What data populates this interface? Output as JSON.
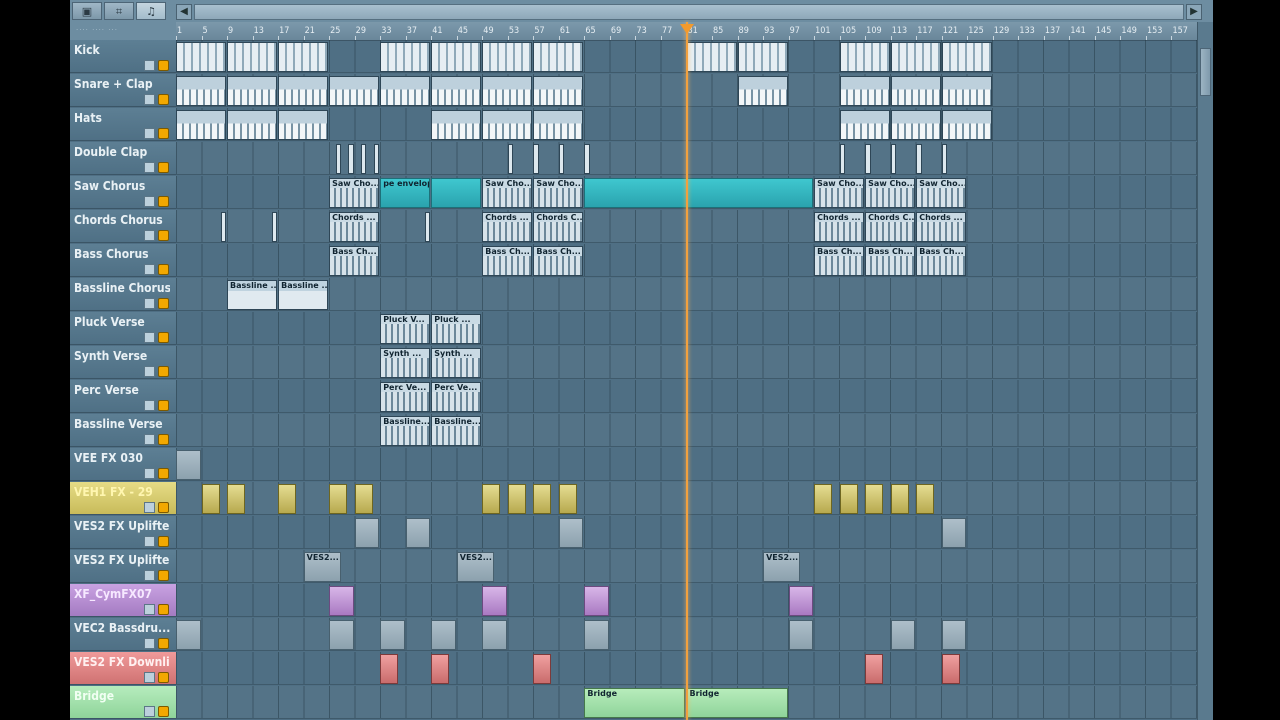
{
  "mode_buttons": [
    "▣",
    "⌗",
    "♫"
  ],
  "presets_label": "···· ···· ···",
  "scroll_arrows": {
    "left": "◀",
    "right": "▶"
  },
  "ruler": {
    "labels": [
      "1",
      "5",
      "9",
      "13",
      "17",
      "21",
      "25",
      "29",
      "33",
      "37",
      "41",
      "45",
      "49",
      "53",
      "57",
      "61",
      "65",
      "69",
      "73",
      "77",
      "81",
      "85",
      "89",
      "93",
      "97",
      "101",
      "105",
      "109",
      "113",
      "117",
      "121",
      "125",
      "129",
      "133",
      "137",
      "141",
      "145",
      "149",
      "153",
      "157"
    ],
    "label_step": 4,
    "bars_visible": 160,
    "playhead_bar": 81
  },
  "tracks": [
    {
      "name": "Kick",
      "color": "default",
      "clips": [
        {
          "start": 1,
          "len": 8,
          "style": "drum"
        },
        {
          "start": 9,
          "len": 8,
          "style": "drum"
        },
        {
          "start": 17,
          "len": 8,
          "style": "drum"
        },
        {
          "start": 33,
          "len": 8,
          "style": "drum"
        },
        {
          "start": 41,
          "len": 8,
          "style": "drum"
        },
        {
          "start": 49,
          "len": 8,
          "style": "drum"
        },
        {
          "start": 57,
          "len": 8,
          "style": "drum"
        },
        {
          "start": 81,
          "len": 8,
          "style": "drum"
        },
        {
          "start": 89,
          "len": 8,
          "style": "drum"
        },
        {
          "start": 105,
          "len": 8,
          "style": "drum"
        },
        {
          "start": 113,
          "len": 8,
          "style": "drum"
        },
        {
          "start": 121,
          "len": 8,
          "style": "drum"
        }
      ]
    },
    {
      "name": "Snare + Clap",
      "color": "default",
      "clips": [
        {
          "start": 1,
          "len": 8,
          "style": "drum2"
        },
        {
          "start": 9,
          "len": 8,
          "style": "drum2"
        },
        {
          "start": 17,
          "len": 8,
          "style": "drum2"
        },
        {
          "start": 25,
          "len": 8,
          "style": "drum2"
        },
        {
          "start": 33,
          "len": 8,
          "style": "drum2"
        },
        {
          "start": 41,
          "len": 8,
          "style": "drum2"
        },
        {
          "start": 49,
          "len": 8,
          "style": "drum2"
        },
        {
          "start": 57,
          "len": 8,
          "style": "drum2"
        },
        {
          "start": 89,
          "len": 8,
          "style": "drum2"
        },
        {
          "start": 105,
          "len": 8,
          "style": "drum2"
        },
        {
          "start": 113,
          "len": 8,
          "style": "drum2"
        },
        {
          "start": 121,
          "len": 8,
          "style": "drum2"
        }
      ]
    },
    {
      "name": "Hats",
      "color": "default",
      "clips": [
        {
          "start": 1,
          "len": 8,
          "style": "drum2"
        },
        {
          "start": 9,
          "len": 8,
          "style": "drum2"
        },
        {
          "start": 17,
          "len": 8,
          "style": "drum2"
        },
        {
          "start": 41,
          "len": 8,
          "style": "drum2"
        },
        {
          "start": 49,
          "len": 8,
          "style": "drum2"
        },
        {
          "start": 57,
          "len": 8,
          "style": "drum2"
        },
        {
          "start": 105,
          "len": 8,
          "style": "drum2"
        },
        {
          "start": 113,
          "len": 8,
          "style": "drum2"
        },
        {
          "start": 121,
          "len": 8,
          "style": "drum2"
        }
      ]
    },
    {
      "name": "Double Clap",
      "color": "default",
      "clips": [
        {
          "start": 26,
          "len": 1,
          "style": "tiny"
        },
        {
          "start": 28,
          "len": 1,
          "style": "tiny"
        },
        {
          "start": 30,
          "len": 1,
          "style": "tiny"
        },
        {
          "start": 32,
          "len": 1,
          "style": "tiny"
        },
        {
          "start": 53,
          "len": 1,
          "style": "tiny"
        },
        {
          "start": 57,
          "len": 1,
          "style": "tiny"
        },
        {
          "start": 61,
          "len": 1,
          "style": "tiny"
        },
        {
          "start": 65,
          "len": 1,
          "style": "tiny"
        },
        {
          "start": 105,
          "len": 1,
          "style": "tiny"
        },
        {
          "start": 109,
          "len": 1,
          "style": "tiny"
        },
        {
          "start": 113,
          "len": 1,
          "style": "tiny"
        },
        {
          "start": 117,
          "len": 1,
          "style": "tiny"
        },
        {
          "start": 121,
          "len": 1,
          "style": "tiny"
        }
      ]
    },
    {
      "name": "Saw Chorus",
      "color": "default",
      "clips": [
        {
          "start": 25,
          "len": 8,
          "style": "pat",
          "label": "Saw Cho..."
        },
        {
          "start": 33,
          "len": 8,
          "style": "cyan",
          "label": "pe envelope"
        },
        {
          "start": 41,
          "len": 8,
          "style": "cyan",
          "label": ""
        },
        {
          "start": 49,
          "len": 8,
          "style": "pat",
          "label": "Saw Cho..."
        },
        {
          "start": 57,
          "len": 8,
          "style": "pat",
          "label": "Saw Cho..."
        },
        {
          "start": 65,
          "len": 36,
          "style": "cyan",
          "label": ""
        },
        {
          "start": 101,
          "len": 8,
          "style": "pat",
          "label": "Saw Cho..."
        },
        {
          "start": 109,
          "len": 8,
          "style": "pat",
          "label": "Saw Cho..."
        },
        {
          "start": 117,
          "len": 8,
          "style": "pat",
          "label": "Saw Cho..."
        }
      ]
    },
    {
      "name": "Chords Chorus",
      "color": "default",
      "clips": [
        {
          "start": 8,
          "len": 1,
          "style": "tiny"
        },
        {
          "start": 16,
          "len": 1,
          "style": "tiny"
        },
        {
          "start": 25,
          "len": 8,
          "style": "pat",
          "label": "Chords ..."
        },
        {
          "start": 40,
          "len": 1,
          "style": "tiny"
        },
        {
          "start": 49,
          "len": 8,
          "style": "pat",
          "label": "Chords ..."
        },
        {
          "start": 57,
          "len": 8,
          "style": "pat",
          "label": "Chords C..."
        },
        {
          "start": 101,
          "len": 8,
          "style": "pat",
          "label": "Chords ..."
        },
        {
          "start": 109,
          "len": 8,
          "style": "pat",
          "label": "Chords C..."
        },
        {
          "start": 117,
          "len": 8,
          "style": "pat",
          "label": "Chords ..."
        }
      ]
    },
    {
      "name": "Bass Chorus",
      "color": "default",
      "clips": [
        {
          "start": 25,
          "len": 8,
          "style": "pat",
          "label": "Bass Ch..."
        },
        {
          "start": 49,
          "len": 8,
          "style": "pat",
          "label": "Bass Ch..."
        },
        {
          "start": 57,
          "len": 8,
          "style": "pat",
          "label": "Bass Ch..."
        },
        {
          "start": 101,
          "len": 8,
          "style": "pat",
          "label": "Bass Ch..."
        },
        {
          "start": 109,
          "len": 8,
          "style": "pat",
          "label": "Bass Ch..."
        },
        {
          "start": 117,
          "len": 8,
          "style": "pat",
          "label": "Bass Ch..."
        }
      ]
    },
    {
      "name": "Bassline Chorus",
      "color": "default",
      "clips": [
        {
          "start": 9,
          "len": 8,
          "style": "wave",
          "label": "Bassline ..."
        },
        {
          "start": 17,
          "len": 8,
          "style": "wave",
          "label": "Bassline ..."
        }
      ]
    },
    {
      "name": "Pluck Verse",
      "color": "default",
      "clips": [
        {
          "start": 33,
          "len": 8,
          "style": "pat",
          "label": "Pluck V..."
        },
        {
          "start": 41,
          "len": 8,
          "style": "pat",
          "label": "Pluck ..."
        }
      ]
    },
    {
      "name": "Synth Verse",
      "color": "default",
      "clips": [
        {
          "start": 33,
          "len": 8,
          "style": "pat",
          "label": "Synth ..."
        },
        {
          "start": 41,
          "len": 8,
          "style": "pat",
          "label": "Synth ..."
        }
      ]
    },
    {
      "name": "Perc Verse",
      "color": "default",
      "clips": [
        {
          "start": 33,
          "len": 8,
          "style": "pat",
          "label": "Perc Ve..."
        },
        {
          "start": 41,
          "len": 8,
          "style": "pat",
          "label": "Perc Ve..."
        }
      ]
    },
    {
      "name": "Bassline Verse",
      "color": "default",
      "clips": [
        {
          "start": 33,
          "len": 8,
          "style": "pat",
          "label": "Bassline..."
        },
        {
          "start": 41,
          "len": 8,
          "style": "pat",
          "label": "Bassline..."
        }
      ]
    },
    {
      "name": "VEE FX 030",
      "color": "default",
      "clips": [
        {
          "start": 1,
          "len": 4,
          "style": "gray",
          "label": ""
        }
      ]
    },
    {
      "name": "VEH1 FX - 29",
      "color": "yellow",
      "clips": [
        {
          "start": 5,
          "len": 3,
          "style": "yellow"
        },
        {
          "start": 9,
          "len": 3,
          "style": "yellow"
        },
        {
          "start": 17,
          "len": 3,
          "style": "yellow"
        },
        {
          "start": 25,
          "len": 3,
          "style": "yellow"
        },
        {
          "start": 29,
          "len": 3,
          "style": "yellow"
        },
        {
          "start": 49,
          "len": 3,
          "style": "yellow"
        },
        {
          "start": 53,
          "len": 3,
          "style": "yellow"
        },
        {
          "start": 57,
          "len": 3,
          "style": "yellow"
        },
        {
          "start": 61,
          "len": 3,
          "style": "yellow"
        },
        {
          "start": 101,
          "len": 3,
          "style": "yellow"
        },
        {
          "start": 105,
          "len": 3,
          "style": "yellow"
        },
        {
          "start": 109,
          "len": 3,
          "style": "yellow"
        },
        {
          "start": 113,
          "len": 3,
          "style": "yellow"
        },
        {
          "start": 117,
          "len": 3,
          "style": "yellow"
        }
      ]
    },
    {
      "name": "VES2 FX Uplifte...",
      "color": "default",
      "clips": [
        {
          "start": 29,
          "len": 4,
          "style": "gray"
        },
        {
          "start": 37,
          "len": 4,
          "style": "gray"
        },
        {
          "start": 61,
          "len": 4,
          "style": "gray"
        },
        {
          "start": 121,
          "len": 4,
          "style": "gray"
        }
      ]
    },
    {
      "name": "VES2 FX Uplifte...",
      "color": "default",
      "clips": [
        {
          "start": 21,
          "len": 6,
          "style": "gray",
          "label": "VES2..."
        },
        {
          "start": 45,
          "len": 6,
          "style": "gray",
          "label": "VES2..."
        },
        {
          "start": 93,
          "len": 6,
          "style": "gray",
          "label": "VES2..."
        }
      ]
    },
    {
      "name": "XF_CymFX07",
      "color": "lilac",
      "clips": [
        {
          "start": 25,
          "len": 4,
          "style": "lilac"
        },
        {
          "start": 49,
          "len": 4,
          "style": "lilac"
        },
        {
          "start": 65,
          "len": 4,
          "style": "lilac"
        },
        {
          "start": 97,
          "len": 4,
          "style": "lilac"
        }
      ]
    },
    {
      "name": "VEC2 Bassdru...",
      "color": "default",
      "clips": [
        {
          "start": 1,
          "len": 4,
          "style": "gray"
        },
        {
          "start": 25,
          "len": 4,
          "style": "gray"
        },
        {
          "start": 33,
          "len": 4,
          "style": "gray"
        },
        {
          "start": 41,
          "len": 4,
          "style": "gray"
        },
        {
          "start": 49,
          "len": 4,
          "style": "gray"
        },
        {
          "start": 65,
          "len": 4,
          "style": "gray"
        },
        {
          "start": 97,
          "len": 4,
          "style": "gray"
        },
        {
          "start": 113,
          "len": 4,
          "style": "gray"
        },
        {
          "start": 121,
          "len": 4,
          "style": "gray"
        }
      ]
    },
    {
      "name": "VES2 FX Downli...",
      "color": "pink",
      "clips": [
        {
          "start": 33,
          "len": 3,
          "style": "pink"
        },
        {
          "start": 41,
          "len": 3,
          "style": "pink"
        },
        {
          "start": 57,
          "len": 3,
          "style": "pink"
        },
        {
          "start": 109,
          "len": 3,
          "style": "pink"
        },
        {
          "start": 121,
          "len": 3,
          "style": "pink"
        }
      ]
    },
    {
      "name": "Bridge",
      "color": "green",
      "clips": [
        {
          "start": 65,
          "len": 16,
          "style": "green",
          "label": "Bridge"
        },
        {
          "start": 81,
          "len": 16,
          "style": "green",
          "label": "Bridge"
        }
      ]
    }
  ],
  "colors": {
    "background": "#4f6f84",
    "playhead": "#f2a13e",
    "track_yellow": "#e3d87b",
    "track_lilac": "#c79be0",
    "track_pink": "#e98a8a",
    "track_green": "#9fe3a9"
  },
  "icons": [
    "pattern-icon",
    "mute-led-icon",
    "playhead-marker-icon",
    "scroll-left-icon",
    "scroll-right-icon"
  ]
}
